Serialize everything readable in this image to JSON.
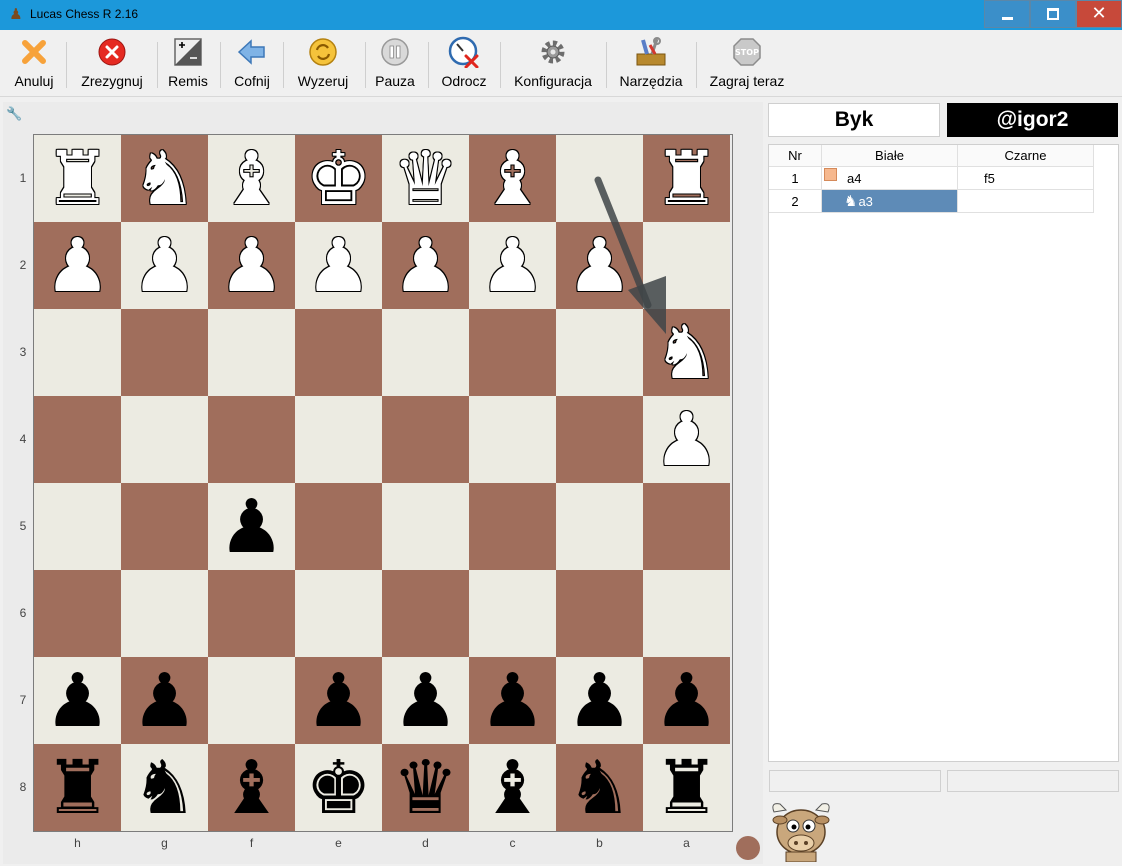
{
  "window": {
    "title": "Lucas Chess R 2.16",
    "controls": {
      "minimize": "minimize",
      "maximize": "maximize",
      "close": "✕"
    }
  },
  "toolbar": {
    "buttons": [
      {
        "label": "Anuluj",
        "icon": "cancel-x-icon"
      },
      {
        "label": "Zrezygnuj",
        "icon": "resign-icon"
      },
      {
        "label": "Remis",
        "icon": "draw-icon"
      },
      {
        "label": "Cofnij",
        "icon": "undo-arrow-icon"
      },
      {
        "label": "Wyzeruj",
        "icon": "reset-icon"
      },
      {
        "label": "Pauza",
        "icon": "pause-icon"
      },
      {
        "label": "Odrocz",
        "icon": "adjourn-clock-icon"
      },
      {
        "label": "Konfiguracja",
        "icon": "gear-icon"
      },
      {
        "label": "Narzędzia",
        "icon": "tools-icon"
      },
      {
        "label": "Zagraj teraz",
        "icon": "stop-icon",
        "icon_text": "STOP"
      }
    ]
  },
  "board": {
    "ranks": [
      "1",
      "2",
      "3",
      "4",
      "5",
      "6",
      "7",
      "8"
    ],
    "files": [
      "h",
      "g",
      "f",
      "e",
      "d",
      "c",
      "b",
      "a"
    ],
    "squares": [
      [
        "wR",
        "wN",
        "wB",
        "wK",
        "wQ",
        "wB",
        "",
        "wR"
      ],
      [
        "wP",
        "wP",
        "wP",
        "wP",
        "wP",
        "wP",
        "wP",
        ""
      ],
      [
        "",
        "",
        "",
        "",
        "",
        "",
        "",
        "wN"
      ],
      [
        "",
        "",
        "",
        "",
        "",
        "",
        "",
        "wP"
      ],
      [
        "",
        "",
        "bP",
        "",
        "",
        "",
        "",
        ""
      ],
      [
        "",
        "",
        "",
        "",
        "",
        "",
        "",
        ""
      ],
      [
        "bP",
        "bP",
        "",
        "bP",
        "bP",
        "bP",
        "bP",
        "bP"
      ],
      [
        "bR",
        "bN",
        "bB",
        "bK",
        "bQ",
        "bB",
        "bN",
        "bR"
      ]
    ],
    "last_move": {
      "from": "b1",
      "to": "a3"
    },
    "colors": {
      "light": "#ecebe2",
      "dark": "#a06e5c"
    }
  },
  "players": {
    "white": "Byk",
    "black": "@igor2"
  },
  "moves": {
    "headers": [
      "Nr",
      "Białe",
      "Czarne"
    ],
    "rows": [
      {
        "nr": "1",
        "white": "a4",
        "black": "f5"
      },
      {
        "nr": "2",
        "white": "a3",
        "black": ""
      }
    ],
    "selected_row": 1
  }
}
